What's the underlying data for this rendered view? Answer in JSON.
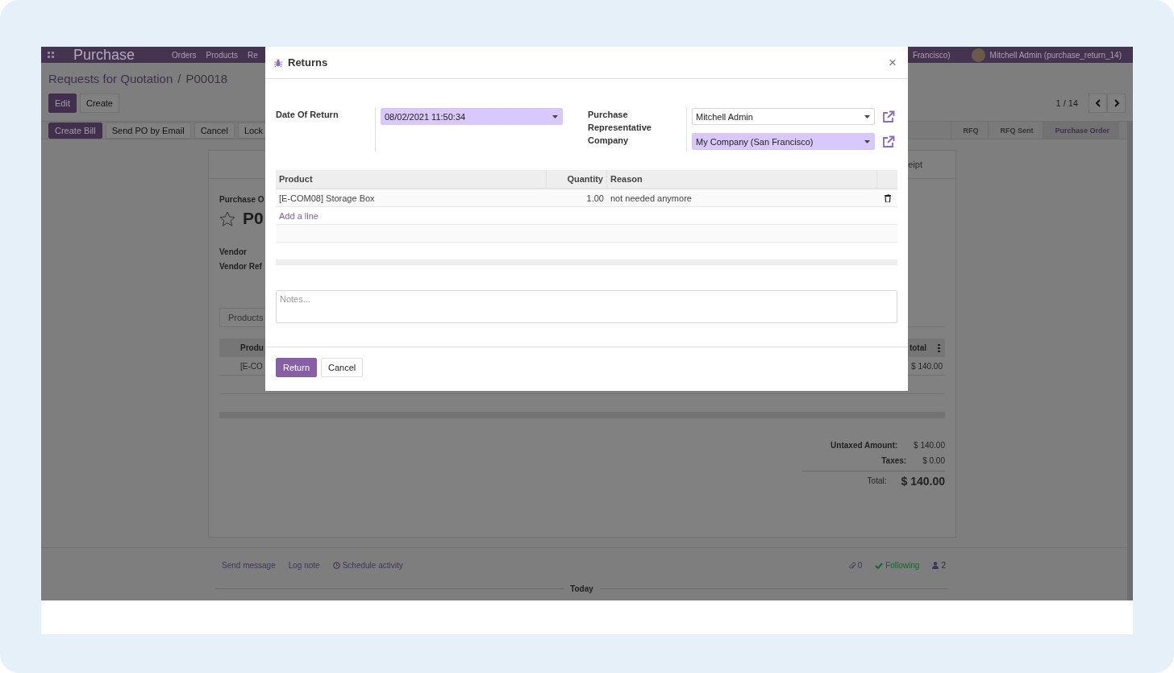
{
  "navbar": {
    "app": "Purchase",
    "menu": [
      "Orders",
      "Products",
      "Re"
    ],
    "company": "Francisco)",
    "user": "Mitchell Admin (purchase_return_14)"
  },
  "breadcrumb": {
    "parent": "Requests for Quotation",
    "separator": "/",
    "current": "P00018"
  },
  "actions": [
    {
      "label": "Edit",
      "primary": true
    },
    {
      "label": "Create",
      "primary": false
    }
  ],
  "pager": "1 / 14",
  "header_buttons": [
    {
      "label": "Create Bill",
      "primary": true
    },
    {
      "label": "Send PO by Email",
      "primary": false
    },
    {
      "label": "Cancel",
      "primary": false
    },
    {
      "label": "Lock",
      "primary": false
    }
  ],
  "statusbar": [
    {
      "label": "RFQ",
      "selected": false
    },
    {
      "label": "RFQ Sent",
      "selected": false
    },
    {
      "label": "Purchase Order",
      "selected": true
    }
  ],
  "form": {
    "smart_button": "eipt",
    "title_label": "Purchase O",
    "name": "P0",
    "starred": false,
    "fields": [
      "Vendor",
      "Vendor Ref"
    ],
    "tabs": [
      {
        "label": "Products",
        "selected": true
      }
    ],
    "columns": [
      "Produ",
      "total"
    ],
    "rows": [
      {
        "product": "[E-CO",
        "subtotal": "$ 140.00"
      }
    ],
    "totals": [
      {
        "label": "Untaxed Amount:",
        "value": "$ 140.00",
        "kind": "line"
      },
      {
        "label": "Taxes:",
        "value": "$ 0.00",
        "kind": "line"
      },
      {
        "label": "Total:",
        "value": "$ 140.00",
        "kind": "grand"
      }
    ]
  },
  "chatter": {
    "actions": [
      {
        "label": "Send message",
        "kind": "plain"
      },
      {
        "label": "Log note",
        "kind": "plain"
      },
      {
        "label": "Schedule activity",
        "kind": "clock"
      }
    ],
    "attachments": "0",
    "following": "Following",
    "followers": "2",
    "divider": "Today"
  },
  "dialog": {
    "title": "Returns",
    "close": "×",
    "fields": [
      {
        "label": "Date Of Return",
        "inputs": [
          {
            "value": "08/02/2021 11:50:34",
            "required": true,
            "link": false
          }
        ]
      },
      {
        "label": "Purchase Representative Company",
        "inputs": [
          {
            "value": "Mitchell Admin",
            "required": false,
            "link": true
          },
          {
            "value": "My Company (San Francisco)",
            "required": true,
            "link": true
          }
        ]
      }
    ],
    "table": {
      "columns": [
        "Product",
        "Quantity",
        "Reason"
      ],
      "rows": [
        {
          "product": "[E-COM08] Storage Box",
          "quantity": "1.00",
          "reason": "not needed anymore"
        }
      ],
      "add_line": "Add a line"
    },
    "notes": {
      "placeholder": "Notes..."
    },
    "buttons": [
      {
        "label": "Return",
        "primary": true
      },
      {
        "label": "Cancel",
        "primary": false
      }
    ]
  }
}
